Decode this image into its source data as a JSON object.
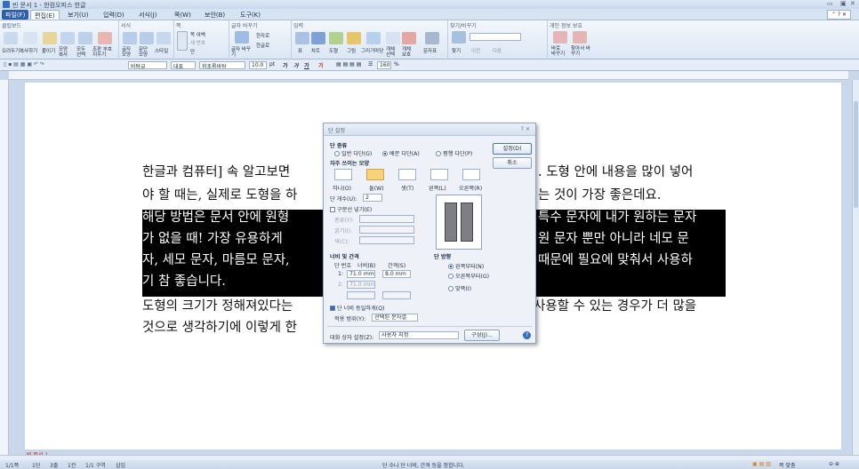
{
  "window": {
    "title": "빈 문서 1 - 한컴오피스 한글"
  },
  "menu": [
    "파일(F)",
    "편집(E)",
    "보기(U)",
    "입력(D)",
    "서식(J)",
    "쪽(W)",
    "보안(B)",
    "도구(K)"
  ],
  "ribbon": {
    "groups": [
      "클립보드",
      "서식",
      "쪽",
      "글자 바꾸기",
      "입력",
      "찾기/바꾸기",
      "개인 정보 보호"
    ],
    "clipboard": [
      "오려두기",
      "복사하기",
      "붙이기",
      "모양 복사",
      "모두 선택",
      "조판 부호 지우기"
    ],
    "format": [
      "글자 모양",
      "문단 모양",
      "스타일"
    ],
    "page": [
      "쪽 여백",
      "새 번호",
      "단"
    ],
    "convert": [
      "글자 바꾸기",
      "한자로",
      "한글로"
    ],
    "insert": [
      "표",
      "차트",
      "도형",
      "그림",
      "그리기마당",
      "개체 선택",
      "개체 보호",
      "문자표"
    ],
    "find": [
      "찾기",
      "이전",
      "다음"
    ],
    "privacy": [
      "바로 바꾸기",
      "찾아서 바꾸기"
    ]
  },
  "toolbar": {
    "style": "바탕글",
    "lang": "대표",
    "font": "함초롬바탕",
    "size": "10.0",
    "size_unit": "pt",
    "zoom": "160",
    "zoom_unit": "%"
  },
  "document": {
    "lines": [
      {
        "text": "한글과 컴퓨터] 속 알고보면",
        "text2": ". 도형 안에 내용을 많이 넣어",
        "hl": false
      },
      {
        "text": "야 할 때는, 실제로 도형을 하",
        "text2": "는 것이 가장 좋은데요.",
        "hl": false
      },
      {
        "text": "해당 방법은 문서 안에 원형",
        "text2": "특수 문자에 내가 원하는 문자",
        "hl": true
      },
      {
        "text": "가 없을 때! 가장 유용하게 ",
        "text2": "원 문자 뿐만 아니라 네모 문",
        "hl": true
      },
      {
        "text": "자, 세모 문자, 마름모 문자,",
        "text2": "때문에 필요에 맞춰서 사용하",
        "hl": true
      },
      {
        "text": "기 참 좋습니다.",
        "text2": "",
        "hl": true
      },
      {
        "text": "도형의 크기가 정해져있다는",
        "text2": "사용할 수 있는 경우가 더 많을",
        "hl": false
      },
      {
        "text": "것으로 생각하기에 이렇게 한",
        "text2": "",
        "hl": false
      }
    ]
  },
  "dialog": {
    "title": "단 설정",
    "title_controls": "? ×",
    "col_type_label": "단 종류",
    "col_types": [
      "일반 다단(G)",
      "배분 다단(A)",
      "평행 다단(P)"
    ],
    "col_type_selected": 1,
    "presets_label": "자주 쓰이는 모양",
    "presets": [
      "하나(O)",
      "둘(W)",
      "셋(T)",
      "왼쪽(L)",
      "오른쪽(R)"
    ],
    "preset_selected": 1,
    "col_count_label": "단 개수(U):",
    "col_count": "2",
    "divider_label": "구분선 넣기(E)",
    "divider_fields": [
      "종류(Y):",
      "굵기(I):",
      "색(C):"
    ],
    "width_label": "너비 및 간격",
    "width_headers": [
      "단 번호",
      "너비(B)",
      "간격(S)"
    ],
    "rows": [
      {
        "n": "1:",
        "w": "71.0 mm",
        "g": "8.0 mm"
      },
      {
        "n": "2:",
        "w": "71.0 mm",
        "g": ""
      }
    ],
    "dir_label": "단 방향",
    "directions": [
      "왼쪽부터(N)",
      "오른쪽부터(G)",
      "맞쪽(I)"
    ],
    "dir_selected": 0,
    "same_width": "단 너비 동일하게(Q)",
    "apply_label": "적용 범위(Y):",
    "apply_value": "선택된 문자열",
    "setting_label": "대화 상자 설정(Z):",
    "setting_value": "사용자 지정",
    "btn_settings": "설정(D)",
    "btn_cancel": "취소",
    "btn_compose": "구성(J)..."
  },
  "status": {
    "items": [
      "1/1쪽",
      "1단",
      "3줄",
      "1칸",
      "1/1 구역",
      "삽입"
    ],
    "hint": "단 수나 단 너비, 간격 등을 정합니다.",
    "view_zoom": "쪽 맞춤"
  },
  "doc_tab": "빈 문서 1"
}
